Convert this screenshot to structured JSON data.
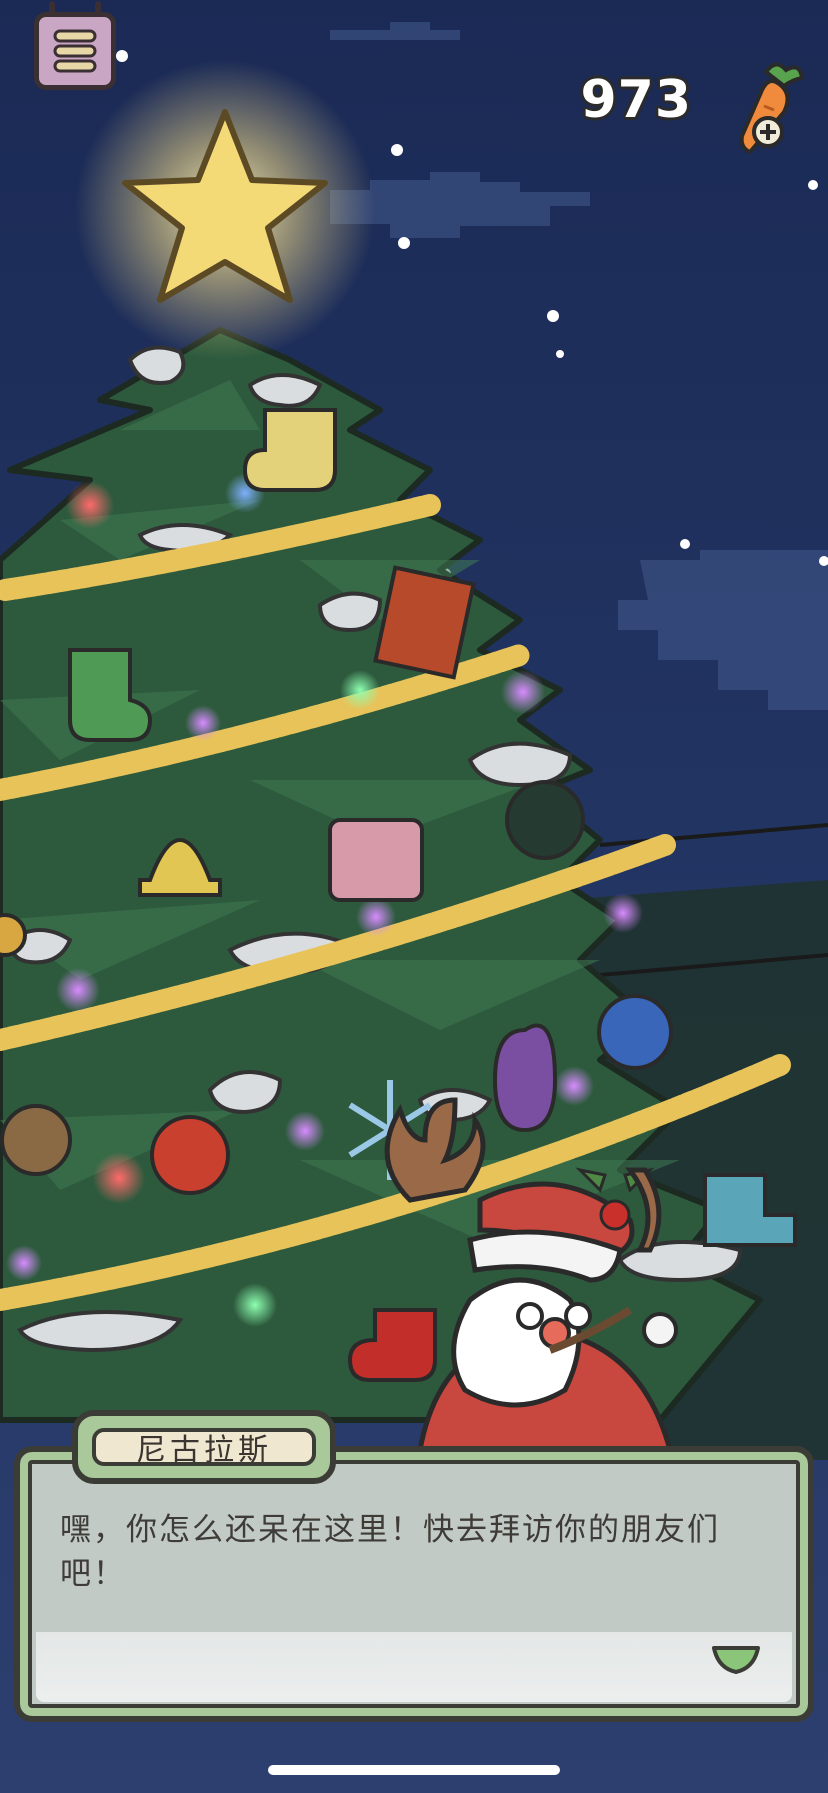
{
  "currency": {
    "carrot_count": "973",
    "icon": "carrot-add-icon"
  },
  "menu": {
    "icon": "menu-icon"
  },
  "dialog": {
    "speaker": "尼古拉斯",
    "lines": [
      "嘿，你怎么还呆在这里！快去拜访你的朋友们",
      "吧！"
    ],
    "next_icon": "next-arrow-icon"
  },
  "colors": {
    "sky_top": "#1b2a55",
    "sky_bottom": "#2c3f6e",
    "tree": "#2d5a3d",
    "garland": "#e8c35a",
    "dialog_frame": "#a9c99a",
    "name_tag_fill": "#efe7cf"
  }
}
